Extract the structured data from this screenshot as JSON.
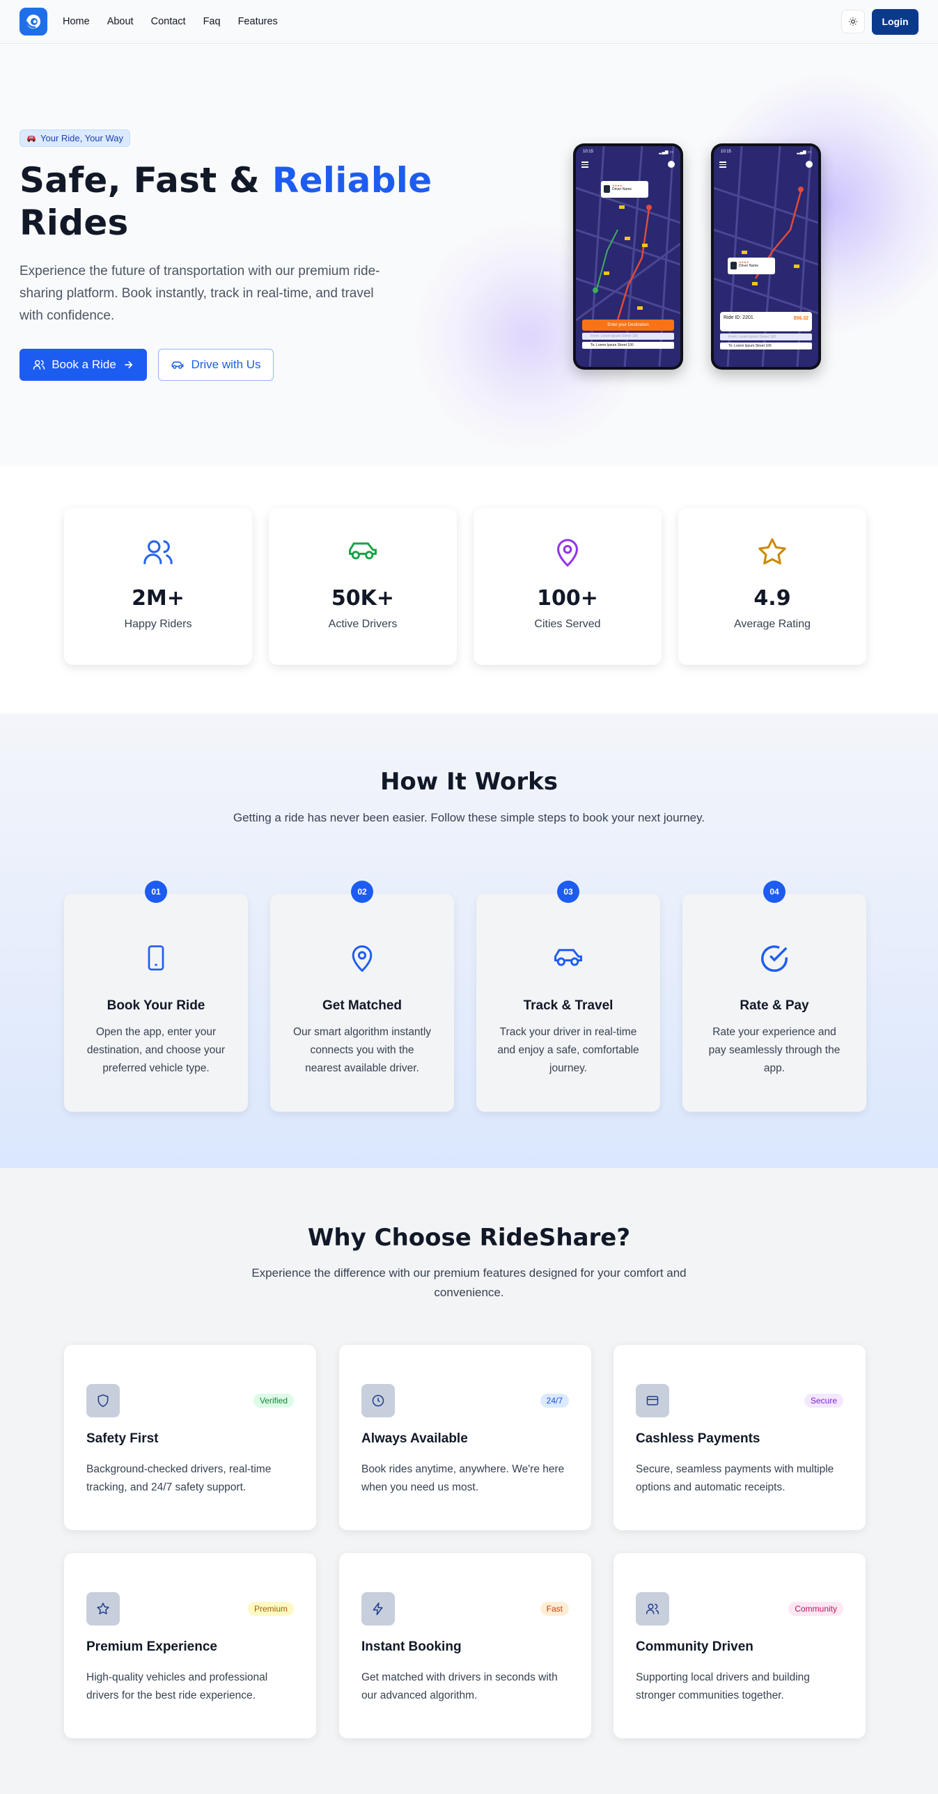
{
  "nav": {
    "links": [
      "Home",
      "About",
      "Contact",
      "Faq",
      "Features"
    ],
    "login": "Login"
  },
  "hero": {
    "badge": "Your Ride, Your Way",
    "title_part1": "Safe, Fast & ",
    "title_accent": "Reliable",
    "title_part2": "Rides",
    "subtitle": "Experience the future of transportation with our premium ride-sharing platform. Book instantly, track in real-time, and travel with confidence.",
    "primary_button": "Book a Ride",
    "secondary_button": "Drive with Us"
  },
  "phones": {
    "left": {
      "time": "10:15",
      "driver_name": "Driver Name",
      "cta": "Enter your Destination",
      "from": "From: Lorem Ipsum Street 100",
      "to": "To: Lorem Ipsum Street 100"
    },
    "right": {
      "time": "10:15",
      "driver_name": "Driver Name",
      "ride_id": "Ride ID: 2201",
      "price": "$56.32",
      "from": "From: Lorem Ipsum Street 100",
      "to": "To: Lorem Ipsum Street 100"
    }
  },
  "stats": [
    {
      "icon": "users-icon",
      "value": "2M+",
      "label": "Happy Riders",
      "color": "#2563eb"
    },
    {
      "icon": "car-icon",
      "value": "50K+",
      "label": "Active Drivers",
      "color": "#16a34a"
    },
    {
      "icon": "map-pin-icon",
      "value": "100+",
      "label": "Cities Served",
      "color": "#9333ea"
    },
    {
      "icon": "star-icon",
      "value": "4.9",
      "label": "Average Rating",
      "color": "#ca8a04"
    }
  ],
  "how": {
    "title": "How It Works",
    "subtitle": "Getting a ride has never been easier. Follow these simple steps to book your next journey.",
    "steps": [
      {
        "num": "01",
        "icon": "phone-icon",
        "title": "Book Your Ride",
        "desc": "Open the app, enter your destination, and choose your preferred vehicle type."
      },
      {
        "num": "02",
        "icon": "map-pin-icon",
        "title": "Get Matched",
        "desc": "Our smart algorithm instantly connects you with the nearest available driver."
      },
      {
        "num": "03",
        "icon": "car-icon",
        "title": "Track & Travel",
        "desc": "Track your driver in real-time and enjoy a safe, comfortable journey."
      },
      {
        "num": "04",
        "icon": "check-circle-icon",
        "title": "Rate & Pay",
        "desc": "Rate your experience and pay seamlessly through the app."
      }
    ]
  },
  "features": {
    "title": "Why Choose RideShare?",
    "subtitle": "Experience the difference with our premium features designed for your comfort and convenience.",
    "items": [
      {
        "icon": "shield-icon",
        "tag": "Verified",
        "tag_bg": "#dcfce7",
        "tag_color": "#15803d",
        "title": "Safety First",
        "desc": "Background-checked drivers, real-time tracking, and 24/7 safety support."
      },
      {
        "icon": "clock-icon",
        "tag": "24/7",
        "tag_bg": "#dbeafe",
        "tag_color": "#1d4ed8",
        "title": "Always Available",
        "desc": "Book rides anytime, anywhere. We're here when you need us most."
      },
      {
        "icon": "credit-card-icon",
        "tag": "Secure",
        "tag_bg": "#f3e8ff",
        "tag_color": "#7e22ce",
        "title": "Cashless Payments",
        "desc": "Secure, seamless payments with multiple options and automatic receipts."
      },
      {
        "icon": "star-icon",
        "tag": "Premium",
        "tag_bg": "#fef9c3",
        "tag_color": "#a16207",
        "title": "Premium Experience",
        "desc": "High-quality vehicles and professional drivers for the best ride experience."
      },
      {
        "icon": "zap-icon",
        "tag": "Fast",
        "tag_bg": "#ffedd5",
        "tag_color": "#c2410c",
        "title": "Instant Booking",
        "desc": "Get matched with drivers in seconds with our advanced algorithm."
      },
      {
        "icon": "users-icon",
        "tag": "Community",
        "tag_bg": "#fce7f3",
        "tag_color": "#be185d",
        "title": "Community Driven",
        "desc": "Supporting local drivers and building stronger communities together."
      }
    ]
  }
}
